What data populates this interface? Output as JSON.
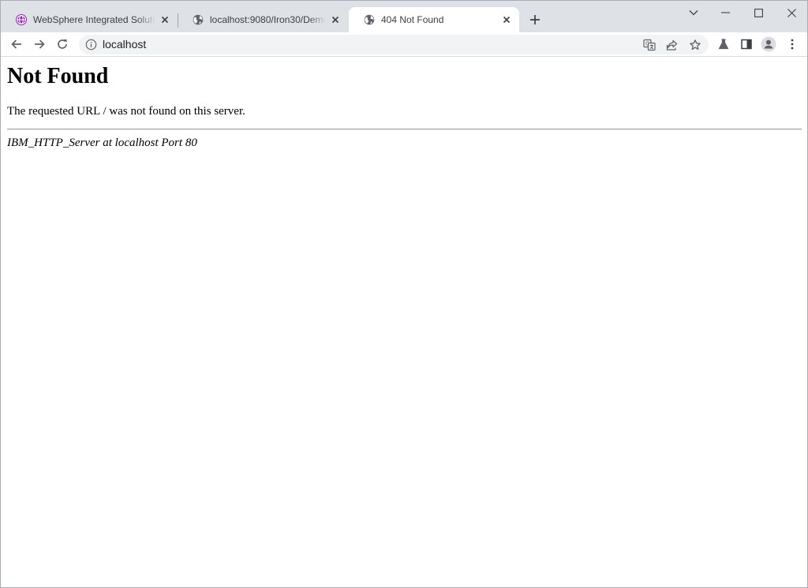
{
  "tabs": [
    {
      "title": "WebSphere Integrated Solutions Console",
      "icon": "websphere-globe-icon"
    },
    {
      "title": "localhost:9080/Iron30/DemoServlet",
      "icon": "globe-icon"
    },
    {
      "title": "404 Not Found",
      "icon": "globe-icon",
      "active": true
    }
  ],
  "address_bar": {
    "url": "localhost"
  },
  "page": {
    "heading": "Not Found",
    "message": "The requested URL / was not found on this server.",
    "server_signature": "IBM_HTTP_Server at localhost Port 80"
  },
  "colors": {
    "tabstrip": "#dee1e6",
    "active_tab": "#ffffff",
    "omnibox": "#f1f3f4",
    "icon": "#5f6368",
    "websphere_purple": "#8e24aa"
  }
}
